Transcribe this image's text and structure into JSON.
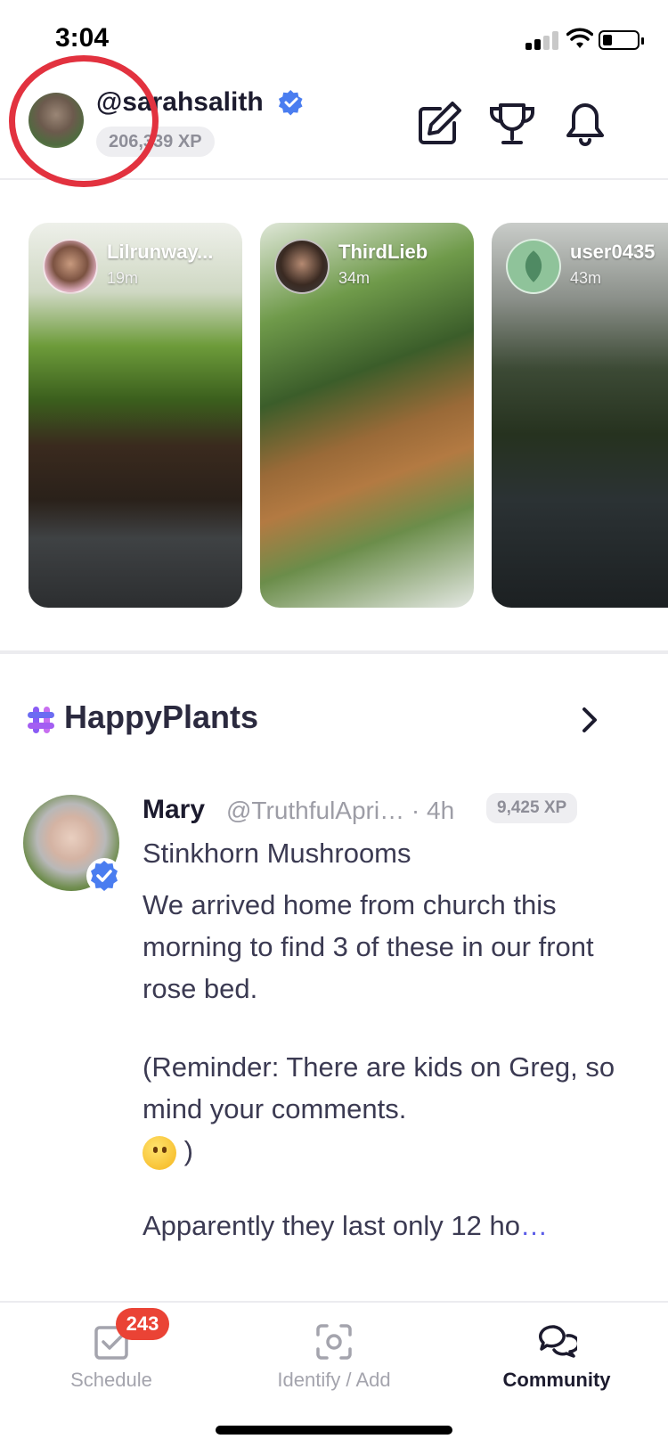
{
  "status_bar": {
    "time": "3:04"
  },
  "header": {
    "username": "@sarahsalith",
    "xp": "206,339 XP",
    "icons": [
      "compose-icon",
      "trophy-icon",
      "bell-icon"
    ]
  },
  "stories": [
    {
      "name": "Lilrunway...",
      "time": "19m"
    },
    {
      "name": "ThirdLieb",
      "time": "34m"
    },
    {
      "name": "user0435",
      "time": "43m"
    }
  ],
  "group": {
    "name": "HappyPlants"
  },
  "post": {
    "author": "Mary",
    "handle": "@TruthfulApri…",
    "time": "· 4h",
    "xp": "9,425 XP",
    "title": "Stinkhorn Mushrooms",
    "para1": "We arrived home from church this morning to find 3 of these in our front rose bed.",
    "para2": "(Reminder: There are kids on Greg, so mind your comments.",
    "para2_close": ")",
    "para3": "Apparently they last only 12 ho",
    "read_more": "…"
  },
  "tabbar": {
    "tabs": [
      {
        "label": "Schedule",
        "badge": "243"
      },
      {
        "label": "Identify / Add"
      },
      {
        "label": "Community"
      }
    ]
  },
  "colors": {
    "accent": "#4a7df0",
    "badge": "#ea4335",
    "highlight_ring": "#e2323f",
    "group_icon": "#8a5cf5"
  }
}
